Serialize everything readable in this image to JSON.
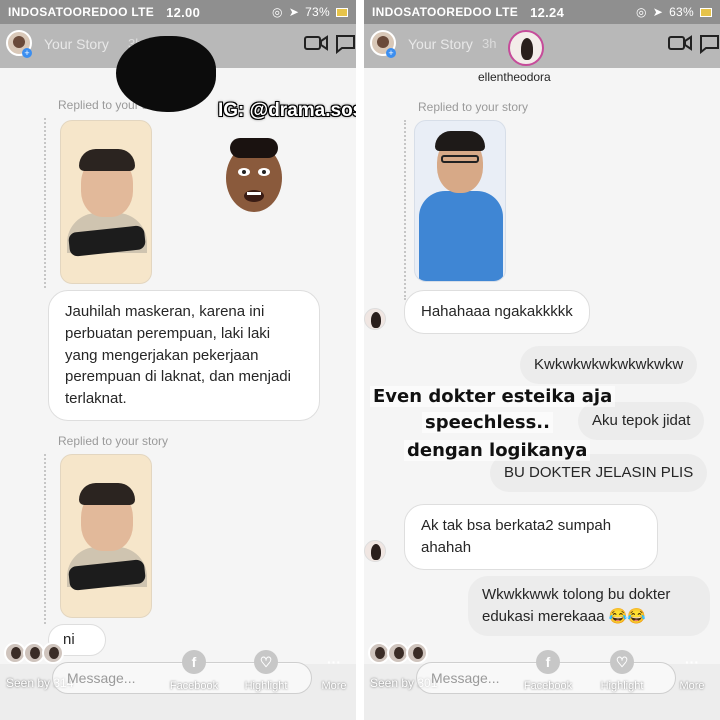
{
  "left": {
    "status": {
      "carrier": "INDOSATOOREDOO LTE",
      "time": "12.00",
      "battery": "73%"
    },
    "story": {
      "label": "Your Story",
      "time": "3h"
    },
    "replied_label_1": "Replied to your story",
    "replied_label_2": "Replied to your story",
    "message_1": "Jauhilah maskeran, karena ini perbuatan perempuan, laki laki yang mengerjakan pekerjaan perempuan di laknat, dan menjadi terlaknat.",
    "message_partial": "ni",
    "watermark": "IG: @drama.sosialmedia",
    "seen": "Seen by 314",
    "message_placeholder": "Message...",
    "actions": [
      "Facebook",
      "Highlight",
      "More"
    ]
  },
  "right": {
    "status": {
      "carrier": "INDOSATOOREDOO LTE",
      "time": "12.24",
      "battery": "63%"
    },
    "story": {
      "label": "Your Story",
      "time": "3h"
    },
    "username": "ellentheodora",
    "replied_label": "Replied to your story",
    "messages": {
      "m1": "Hahahaaa ngakakkkkk",
      "m2": "Kwkwkwkwkwkwkwkw",
      "m3": "Aku tepok jidat",
      "m4": "BU DOKTER JELASIN PLIS",
      "m5": "Ak tak bsa berkata2 sumpah ahahah",
      "m6": "Wkwkkwwk tolong bu dokter edukasi merekaaa 😂😂"
    },
    "caption": [
      "Even dokter esteika aja",
      "speechless..",
      "dengan logikanya"
    ],
    "seen": "Seen by 301",
    "message_placeholder": "Message...",
    "actions": [
      "Facebook",
      "Highlight",
      "More"
    ]
  }
}
